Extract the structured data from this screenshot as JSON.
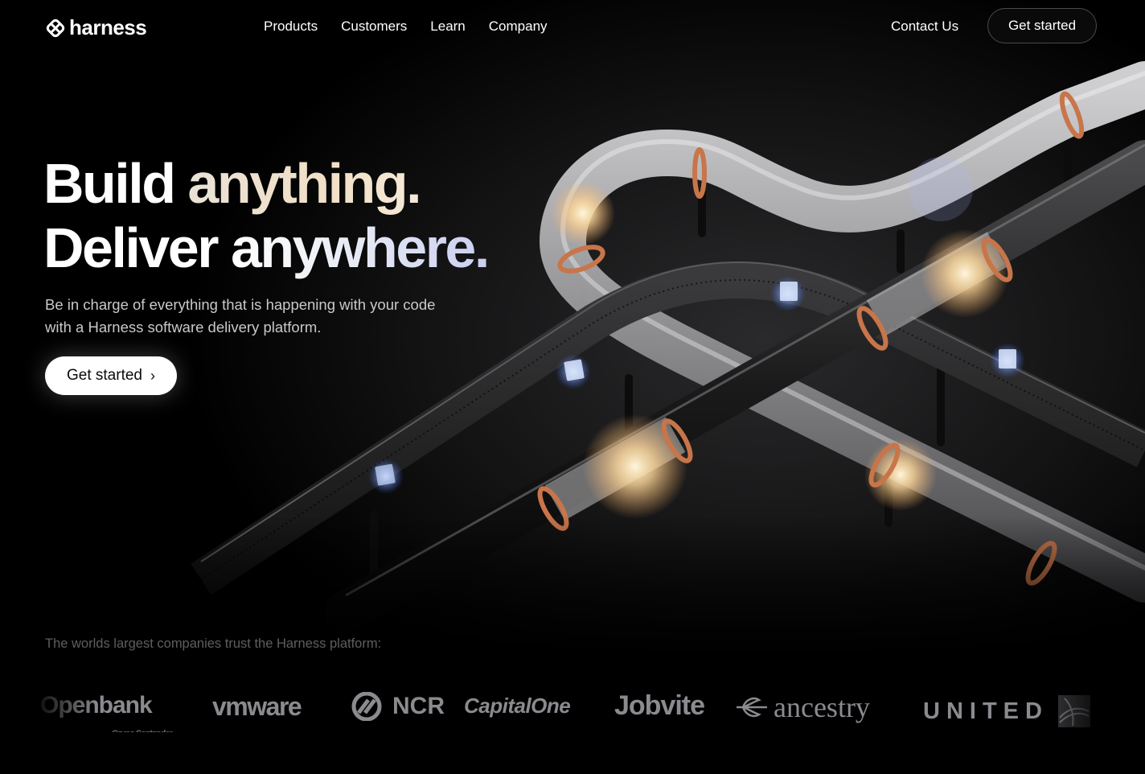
{
  "nav": {
    "logo_text": "harness",
    "links": [
      "Products",
      "Customers",
      "Learn",
      "Company"
    ],
    "contact_label": "Contact Us",
    "cta_label": "Get started"
  },
  "hero": {
    "line1_a": "Build ",
    "line1_b": "anything.",
    "line2_a": "Deliver ",
    "line2_b": "anywhere.",
    "subtitle": "Be in charge of everything that is happening with your code with a Harness software delivery platform.",
    "cta_label": "Get started"
  },
  "trust": {
    "text": "The worlds largest companies trust the Harness platform:",
    "logos": [
      {
        "name": "Openbank",
        "text": "Openbank",
        "sub": "Grupo Santander"
      },
      {
        "name": "VMware",
        "text": "vmware"
      },
      {
        "name": "NCR",
        "text": "NCR"
      },
      {
        "name": "Capital One",
        "text": "CapitalOne"
      },
      {
        "name": "Jobvite",
        "text": "Jobvite"
      },
      {
        "name": "Ancestry",
        "text": "ancestry"
      },
      {
        "name": "United",
        "text": "UNITED"
      }
    ]
  },
  "colors": {
    "background": "#000000",
    "text_primary": "#ffffff",
    "text_muted": "#c9c9cc",
    "trust_text": "#5e5e62",
    "logo_grey": "#8a8a8f",
    "copper": "#c8754a",
    "glow_warm": "#ffe3b0",
    "cube_blue": "#9ec5ff"
  }
}
